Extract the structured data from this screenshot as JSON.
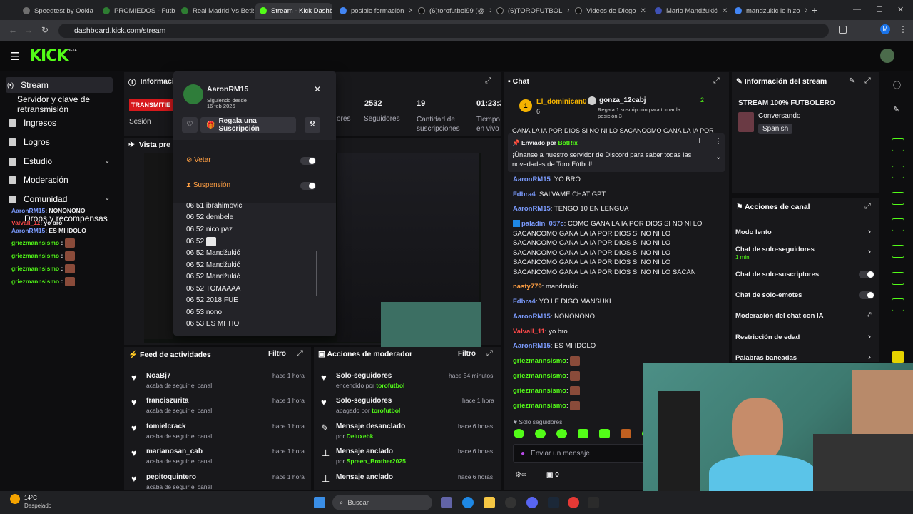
{
  "browser": {
    "tabs": [
      {
        "title": "Speedtest by Ookla",
        "color": "#6f6f6f"
      },
      {
        "title": "PROMIEDOS - Fútbol",
        "color": "#2e7d32"
      },
      {
        "title": "Real Madrid Vs Betis",
        "color": "#2e7d32"
      },
      {
        "title": "Stream - Kick Dashboard",
        "color": "#53fc18"
      },
      {
        "title": "posible formación",
        "color": "#4285f4"
      },
      {
        "title": "(6)torofutbol99 (@",
        "color": "#111111"
      },
      {
        "title": "(6)TOROFUTBOL",
        "color": "#111111"
      },
      {
        "title": "Videos de Diego",
        "color": "#111111"
      },
      {
        "title": "Mario Mandžukić",
        "color": "#3f51b5"
      },
      {
        "title": "mandzukic le hizo",
        "color": "#4285f4"
      }
    ],
    "url": "dashboard.kick.com/stream"
  },
  "kick": {
    "logo": "KICK",
    "beta": "BETA"
  },
  "sidebar": {
    "items": [
      {
        "label": "Stream",
        "icon": "broadcast-icon"
      },
      {
        "label": "Servidor y clave de retransmisión",
        "icon": ""
      },
      {
        "label": "Ingresos",
        "icon": "revenue-icon"
      },
      {
        "label": "Logros",
        "icon": "trophy-icon"
      },
      {
        "label": "Estudio",
        "icon": "studio-icon"
      },
      {
        "label": "Moderación",
        "icon": "shield-icon"
      },
      {
        "label": "Comunidad",
        "icon": "community-icon"
      },
      {
        "label": "Drops y recompensas",
        "icon": "gift-icon"
      }
    ]
  },
  "mini_chat": [
    {
      "user": "AaronRM15",
      "msg": ": NONONONO",
      "color": "#7c9cff"
    },
    {
      "user": "Valvall_11",
      "msg": ": yo bro",
      "color": "#ff4a4a"
    },
    {
      "user": "AaronRM15",
      "msg": ": ES MI IDOLO",
      "color": "#7c9cff"
    },
    {
      "user": "griezmannsismo",
      "msg": " :",
      "color": "#53fc18"
    },
    {
      "user": "griezmannsismo",
      "msg": " :",
      "color": "#53fc18"
    },
    {
      "user": "griezmannsismo",
      "msg": " :",
      "color": "#53fc18"
    },
    {
      "user": "griezmannsismo",
      "msg": " :",
      "color": "#53fc18"
    }
  ],
  "stream_info_panel": {
    "title": "Información",
    "status": "TRANSMITIE",
    "session": "Sesión",
    "stats": [
      {
        "value": "",
        "label": "ores"
      },
      {
        "value": "2532",
        "label": "Seguidores"
      },
      {
        "value": "19",
        "label": "Cantidad de suscripciones"
      },
      {
        "value": "01:23:3",
        "label": "Tiempo en vivo"
      }
    ],
    "preview": "Vista pre"
  },
  "user_card": {
    "username": "AaronRM15",
    "following_label": "Siguiendo desde",
    "following_date": "16 feb 2026",
    "gift_button": "Regala una Suscripción",
    "ban_label": "Vetar",
    "timeout_label": "Suspensión",
    "log": [
      {
        "time": "06:51",
        "text": "ibrahimovic"
      },
      {
        "time": "06:52",
        "text": "dembele"
      },
      {
        "time": "06:52",
        "text": "nico paz"
      },
      {
        "time": "06:52",
        "text": ""
      },
      {
        "time": "06:52",
        "text": "Mandžukić"
      },
      {
        "time": "06:52",
        "text": "Mandžukić"
      },
      {
        "time": "06:52",
        "text": "Mandžukić"
      },
      {
        "time": "06:52",
        "text": "TOMAAAA"
      },
      {
        "time": "06:52",
        "text": "2018 FUE"
      },
      {
        "time": "06:53",
        "text": "nono"
      },
      {
        "time": "06:53",
        "text": "ES MI TIO"
      }
    ]
  },
  "activity_feed": {
    "title": "Feed de actividades",
    "filter": "Filtro",
    "rows": [
      {
        "user": "NoaBj7",
        "desc": "acaba de seguir el canal",
        "time": "hace 1 hora"
      },
      {
        "user": "franciszurita",
        "desc": "acaba de seguir el canal",
        "time": "hace 1 hora"
      },
      {
        "user": "tomielcrack",
        "desc": "acaba de seguir el canal",
        "time": "hace 1 hora"
      },
      {
        "user": "marianosan_cab",
        "desc": "acaba de seguir el canal",
        "time": "hace 1 hora"
      },
      {
        "user": "pepitoquintero",
        "desc": "acaba de seguir el canal",
        "time": "hace 1 hora"
      }
    ]
  },
  "mod_actions": {
    "title": "Acciones de moderador",
    "filter": "Filtro",
    "rows": [
      {
        "title": "Solo-seguidores",
        "desc": "encendido por",
        "by": "torofutbol",
        "time": "hace 54 minutos",
        "icon": "heart-icon"
      },
      {
        "title": "Solo-seguidores",
        "desc": "apagado por",
        "by": "torofutbol",
        "time": "hace 1 hora",
        "icon": "heart-icon"
      },
      {
        "title": "Mensaje desanclado",
        "desc": "por",
        "by": "Deluxebk",
        "time": "hace 6 horas",
        "icon": "unpin-icon"
      },
      {
        "title": "Mensaje anclado",
        "desc": "por",
        "by": "Spreen_Brother2025",
        "time": "hace 6 horas",
        "icon": "pin-icon"
      },
      {
        "title": "Mensaje anclado",
        "desc": "por",
        "by": "",
        "time": "hace 6 horas",
        "icon": "pin-icon"
      }
    ]
  },
  "chat": {
    "title": "Chat",
    "top_gifters": [
      {
        "name": "El_dominican0",
        "count": "6"
      },
      {
        "name": "gonza_12cabj",
        "count": "2"
      }
    ],
    "gift_note": "Regala 1 suscripción para tomar la posición 3",
    "overflow_text": "GANA LA IA POR DIOS SI NO NI LO SACANCOMO GANA LA IA POR",
    "pinned_by_label": "Enviado por",
    "pinned_by": "BotRix",
    "pinned_msg": "¡Únanse a nuestro servidor de Discord para saber todas las novedades de Toro Fútbol!...",
    "messages": [
      {
        "user": "AaronRM15",
        "color": "#7c9cff",
        "text": ": YO BRO"
      },
      {
        "user": "Fdbra4",
        "color": "#7c9cff",
        "text": ": SALVAME CHAT GPT"
      },
      {
        "user": "AaronRM15",
        "color": "#7c9cff",
        "text": ": TENGO 10 EN LENGUA"
      },
      {
        "user": "paladin_057c",
        "color": "#7c9cff",
        "text": ": COMO GANA LA IA POR DIOS SI NO NI LO SACANCOMO GANA LA IA POR DIOS SI NO NI LO SACANCOMO GANA LA IA POR DIOS SI NO NI LO SACANCOMO GANA LA IA POR DIOS SI NO NI LO SACANCOMO GANA LA IA POR DIOS SI NO NI LO SACANCOMO GANA LA IA POR DIOS SI NO NI LO SACAN"
      },
      {
        "user": "nasty779",
        "color": "#ff9f43",
        "text": ": mandzukic"
      },
      {
        "user": "Fdbra4",
        "color": "#7c9cff",
        "text": ": YO LE DIGO MANSUKI"
      },
      {
        "user": "AaronRM15",
        "color": "#7c9cff",
        "text": ": NONONONO"
      },
      {
        "user": "Valvall_11",
        "color": "#ff4a4a",
        "text": ": yo bro"
      },
      {
        "user": "AaronRM15",
        "color": "#7c9cff",
        "text": ": ES MI IDOLO"
      },
      {
        "user": "griezmannsismo",
        "color": "#53fc18",
        "text": ":"
      },
      {
        "user": "griezmannsismo",
        "color": "#53fc18",
        "text": ":"
      },
      {
        "user": "griezmannsismo",
        "color": "#53fc18",
        "text": ":"
      },
      {
        "user": "griezmannsismo",
        "color": "#53fc18",
        "text": ":"
      }
    ],
    "mode": "Solo seguidores",
    "input_placeholder": "Enviar un mensaje",
    "points": "0"
  },
  "stream_info": {
    "title": "Información del stream",
    "stream_title": "STREAM 100% FUTBOLERO",
    "category": "Conversando",
    "language": "Spanish"
  },
  "channel_actions": {
    "title": "Acciones de canal",
    "items": [
      {
        "label": "Modo lento",
        "sub": "",
        "control": "arrow"
      },
      {
        "label": "Chat de solo-seguidores",
        "sub": "1 min",
        "control": "arrow"
      },
      {
        "label": "Chat de solo-suscriptores",
        "sub": "",
        "control": "toggle"
      },
      {
        "label": "Chat de solo-emotes",
        "sub": "",
        "control": "toggle"
      },
      {
        "label": "Moderación del chat con IA",
        "sub": "",
        "control": "external"
      },
      {
        "label": "Restricción de edad",
        "sub": "",
        "control": "arrow"
      },
      {
        "label": "Palabras baneadas",
        "sub": "",
        "control": "arrow"
      }
    ]
  },
  "taskbar": {
    "temp": "14°C",
    "weather": "Despejado",
    "search": "Buscar"
  },
  "colors": {
    "accent": "#53fc18",
    "bg": "#0e0e10",
    "panel": "#18181b",
    "alert": "#d7191c"
  }
}
